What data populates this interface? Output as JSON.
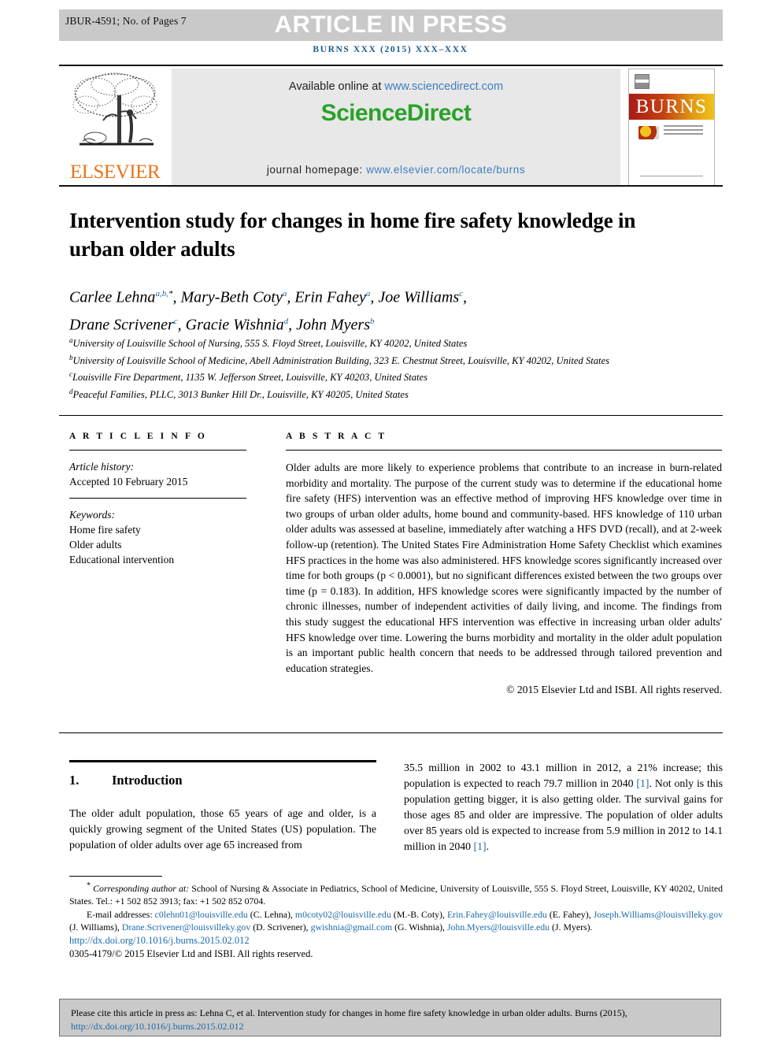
{
  "header": {
    "article_id": "JBUR-4591; No. of Pages 7",
    "press_label": "ARTICLE IN PRESS",
    "journal_ref": "BURNS XXX (2015) XXX–XXX"
  },
  "masthead": {
    "available_prefix": "Available online at ",
    "sciencedirect_url": "www.sciencedirect.com",
    "sciencedirect_logo": "ScienceDirect",
    "homepage_prefix": "journal homepage: ",
    "homepage_url": "www.elsevier.com/locate/burns",
    "publisher": "ELSEVIER",
    "cover_title": "BURNS"
  },
  "article": {
    "title": "Intervention study for changes in home fire safety knowledge in urban older adults",
    "authors_line1_name1": "Carlee Lehna",
    "authors_line1_sup1": "a,b,",
    "authors_line1_star": "*",
    "authors_line1_name2": "Mary-Beth Coty",
    "authors_line1_sup2": "a",
    "authors_line1_name3": "Erin Fahey",
    "authors_line1_sup3": "a",
    "authors_line1_name4": "Joe Williams",
    "authors_line1_sup4": "c",
    "authors_line2_name1": "Drane Scrivener",
    "authors_line2_sup1": "c",
    "authors_line2_name2": "Gracie Wishnia",
    "authors_line2_sup2": "d",
    "authors_line2_name3": "John Myers",
    "authors_line2_sup3": "b",
    "affiliations": [
      {
        "marker": "a",
        "text": "University of Louisville School of Nursing, 555 S. Floyd Street, Louisville, KY 40202, United States"
      },
      {
        "marker": "b",
        "text": "University of Louisville School of Medicine, Abell Administration Building, 323 E. Chestnut Street, Louisville, KY 40202, United States"
      },
      {
        "marker": "c",
        "text": "Louisville Fire Department, 1135 W. Jefferson Street, Louisville, KY 40203, United States"
      },
      {
        "marker": "d",
        "text": "Peaceful Families, PLLC, 3013 Bunker Hill Dr., Louisville, KY 40205, United States"
      }
    ]
  },
  "article_info": {
    "heading": "A R T I C L E   I N F O",
    "history_label": "Article history:",
    "history_value": "Accepted 10 February 2015",
    "keywords_label": "Keywords:",
    "keywords": [
      "Home fire safety",
      "Older adults",
      "Educational intervention"
    ]
  },
  "abstract": {
    "heading": "A B S T R A C T",
    "text": "Older adults are more likely to experience problems that contribute to an increase in burn-related morbidity and mortality. The purpose of the current study was to determine if the educational home fire safety (HFS) intervention was an effective method of improving HFS knowledge over time in two groups of urban older adults, home bound and community-based. HFS knowledge of 110 urban older adults was assessed at baseline, immediately after watching a HFS DVD (recall), and at 2-week follow-up (retention). The United States Fire Administration Home Safety Checklist which examines HFS practices in the home was also administered. HFS knowledge scores significantly increased over time for both groups (p < 0.0001), but no significant differences existed between the two groups over time (p = 0.183). In addition, HFS knowledge scores were significantly impacted by the number of chronic illnesses, number of independent activities of daily living, and income. The findings from this study suggest the educational HFS intervention was effective in increasing urban older adults' HFS knowledge over time. Lowering the burns morbidity and mortality in the older adult population is an important public health concern that needs to be addressed through tailored prevention and education strategies.",
    "copyright": "© 2015 Elsevier Ltd and ISBI. All rights reserved."
  },
  "intro": {
    "number": "1.",
    "heading": "Introduction",
    "left_text": "The older adult population, those 65 years of age and older, is a quickly growing segment of the United States (US) population. The population of older adults over age 65 increased from",
    "right_text_1": "35.5 million in 2002 to 43.1 million in 2012, a 21% increase; this population is expected to reach 79.7 million in 2040 ",
    "right_ref_1": "[1]",
    "right_text_2": ". Not only is this population getting bigger, it is also getting older. The survival gains for those ages 85 and older are impressive. The population of older adults over 85 years old is expected to increase from 5.9 million in 2012 to 14.1 million in 2040 ",
    "right_ref_2": "[1]",
    "right_text_3": "."
  },
  "footnotes": {
    "corresponding_star": "*",
    "corresponding_label": "Corresponding author at:",
    "corresponding_text": " School of Nursing & Associate in Pediatrics, School of Medicine, University of Louisville, 555 S. Floyd Street, Louisville, KY 40202, United States. Tel.: +1 502 852 3913; fax: +1 502 852 0704.",
    "email_label": "E-mail addresses:",
    "emails": [
      {
        "address": "c0lehn01@louisville.edu",
        "person": "(C. Lehna),"
      },
      {
        "address": "m0coty02@louisville.edu",
        "person": "(M.-B. Coty),"
      },
      {
        "address": "Erin.Fahey@louisville.edu",
        "person": "(E. Fahey),"
      },
      {
        "address": "Joseph.Williams@louisvilleky.gov",
        "person": "(J. Williams),"
      },
      {
        "address": "Drane.Scrivener@louisvilleky.gov",
        "person": "(D. Scrivener),"
      },
      {
        "address": "gwishnia@gmail.com",
        "person": "(G. Wishnia),"
      },
      {
        "address": "John.Myers@louisville.edu",
        "person": "(J. Myers)."
      }
    ],
    "doi": "http://dx.doi.org/10.1016/j.burns.2015.02.012",
    "issn": "0305-4179/© 2015 Elsevier Ltd and ISBI. All rights reserved."
  },
  "cite_box": {
    "text": "Please cite this article in press as: Lehna C, et al. Intervention study for changes in home fire safety knowledge in urban older adults. Burns (2015),",
    "link": "http://dx.doi.org/10.1016/j.burns.2015.02.012"
  },
  "colors": {
    "press_bar_bg": "#c9c9c9",
    "journal_ref": "#1a5a8e",
    "link_blue": "#1a6aa8",
    "sciencedirect_green": "#2aa22a",
    "elsevier_orange": "#eb7317"
  }
}
